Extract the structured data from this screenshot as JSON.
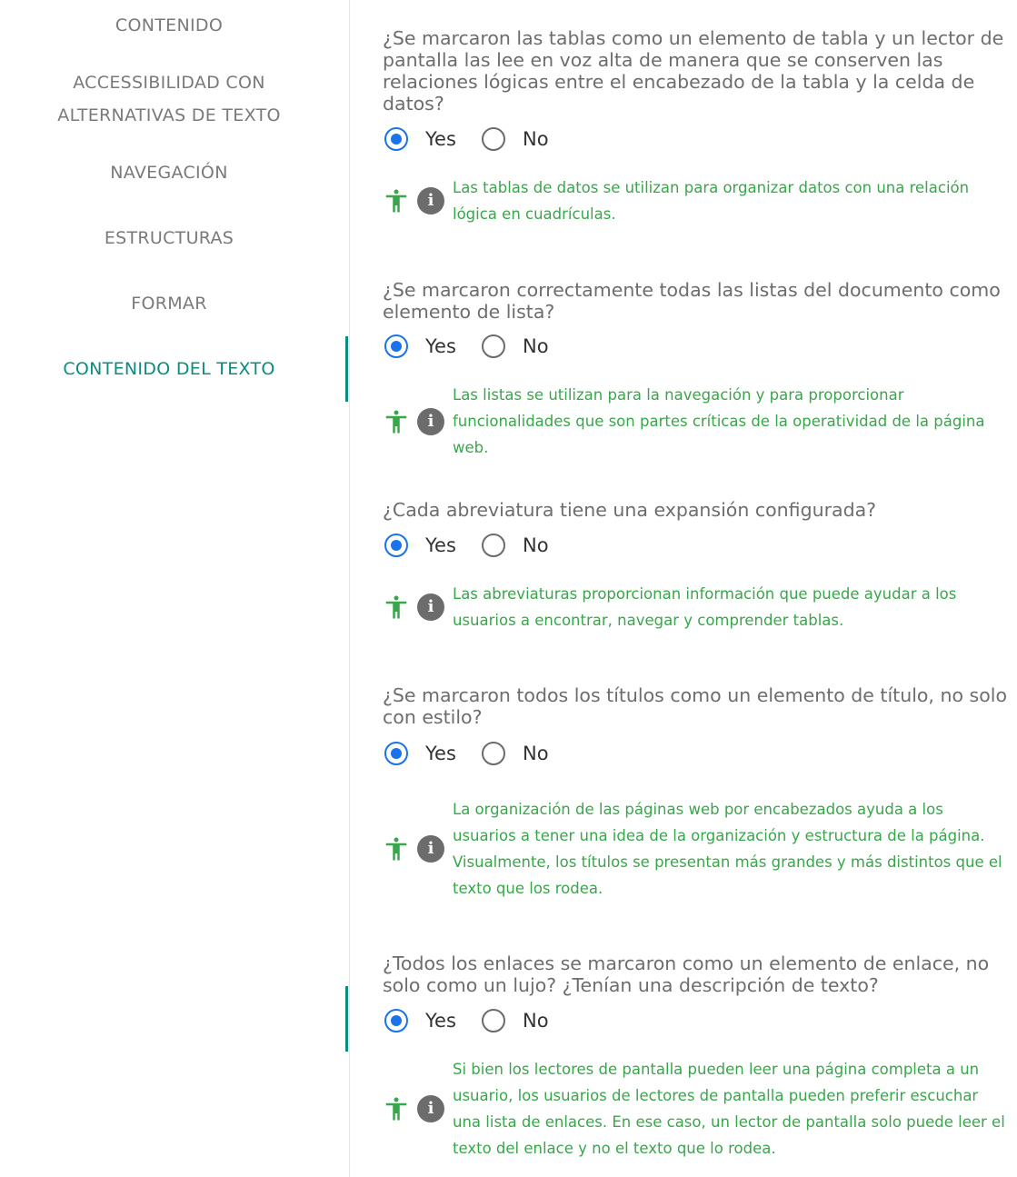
{
  "sidebar": {
    "items": [
      {
        "label": "CONTENIDO",
        "active": false
      },
      {
        "label": "ACCESSIBILIDAD CON ALTERNATIVAS DE TEXTO",
        "active": false
      },
      {
        "label": "NAVEGACIÓN",
        "active": false
      },
      {
        "label": "ESTRUCTURAS",
        "active": false
      },
      {
        "label": "FORMAR",
        "active": false
      },
      {
        "label": "CONTENIDO DEL TEXTO",
        "active": true
      }
    ]
  },
  "colors": {
    "accent": "#0d8b7f",
    "radio_selected": "#1a73e8",
    "tip_text": "#3aa64b",
    "accessibility_icon": "#3aa64b",
    "info_icon": "#6c6c6c"
  },
  "questions": [
    {
      "text": "¿Se marcaron las tablas como un elemento de tabla y un lector de pantalla las lee en voz alta de manera que se conserven las relaciones lógicas entre el encabezado de la tabla y la celda de datos?",
      "yes_label": "Yes",
      "no_label": "No",
      "selected": "Yes",
      "tip": "Las tablas de datos se utilizan para organizar datos con una relación lógica en cuadrículas."
    },
    {
      "text": "¿Se marcaron correctamente todas las listas del documento como elemento de lista?",
      "yes_label": "Yes",
      "no_label": "No",
      "selected": "Yes",
      "tip": "Las listas se utilizan para la navegación y para proporcionar funcionalidades que son partes críticas de la operatividad de la página web."
    },
    {
      "text": "¿Cada abreviatura tiene una expansión configurada?",
      "yes_label": "Yes",
      "no_label": "No",
      "selected": "Yes",
      "tip": "Las abreviaturas proporcionan información que puede ayudar a los usuarios a encontrar, navegar y comprender tablas."
    },
    {
      "text": "¿Se marcaron todos los títulos como un elemento de título, no solo con estilo?",
      "yes_label": "Yes",
      "no_label": "No",
      "selected": "Yes",
      "tip": "La organización de las páginas web por encabezados ayuda a los usuarios a tener una idea de la organización y estructura de la página. Visualmente, los títulos se presentan más grandes y más distintos que el texto que los rodea."
    },
    {
      "text": "¿Todos los enlaces se marcaron como un elemento de enlace, no solo como un lujo? ¿Tenían una descripción de texto?",
      "yes_label": "Yes",
      "no_label": "No",
      "selected": "Yes",
      "tip": "Si bien los lectores de pantalla pueden leer una página completa a un usuario, los usuarios de lectores de pantalla pueden preferir escuchar una lista de enlaces. En ese caso, un lector de pantalla solo puede leer el texto del enlace y no el texto que lo rodea."
    }
  ]
}
